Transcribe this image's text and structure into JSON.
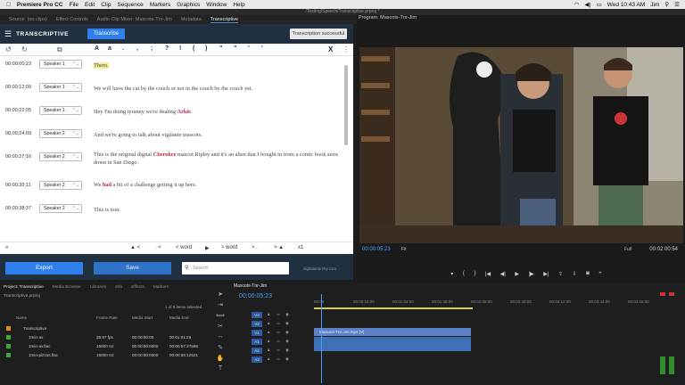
{
  "menubar": {
    "app": "Premiere Pro CC",
    "items": [
      "File",
      "Edit",
      "Clip",
      "Sequence",
      "Markers",
      "Graphics",
      "Window",
      "Help"
    ],
    "clock": "Wed 10:43 AM",
    "user": "Jim"
  },
  "titlebar": "/Testing/Speech/Transcriptive.prproj *",
  "tabs": [
    "Source: (no clips)",
    "Effect Controls",
    "Audio Clip Mixer: Mascots-Tnr-Jim",
    "Metadata",
    "Transcriptive"
  ],
  "transcriptive": {
    "title": "TRANSCRIPTIVE",
    "transcribe_button": "Transcribe",
    "status_button": "Transcription successful",
    "punct": [
      "A",
      "a",
      ".",
      ",",
      ";",
      "?",
      "!",
      "(",
      ")",
      "\"",
      "\"",
      "'",
      "'"
    ],
    "rows": [
      {
        "time": "00;00;00;23",
        "speaker": "Speaker 1",
        "segments": [
          {
            "t": "Thern.",
            "style": "hl"
          }
        ]
      },
      {
        "time": "00;00;12;09",
        "speaker": "Speaker 1",
        "segments": [
          {
            "t": "We will have the cat by the couch or not in the couch by the couch yet.",
            "style": ""
          }
        ]
      },
      {
        "time": "00;00;22;05",
        "speaker": "Speaker 1",
        "segments": [
          {
            "t": "Hey I'm doing tyranny we're dealing ",
            "style": ""
          },
          {
            "t": "Arkie",
            "style": "kw"
          },
          {
            "t": ".",
            "style": ""
          }
        ]
      },
      {
        "time": "00;00;24;09",
        "speaker": "Speaker 2",
        "segments": [
          {
            "t": "And we're going to talk about vigilante mascots.",
            "style": ""
          }
        ]
      },
      {
        "time": "00;00;27;16",
        "speaker": "Speaker 2",
        "segments": [
          {
            "t": "This is the original digital ",
            "style": ""
          },
          {
            "t": "Cherokee",
            "style": "kw"
          },
          {
            "t": " mascot Ripley and it's an alien that I bought in from a comic book store down in San Diego.",
            "style": ""
          }
        ]
      },
      {
        "time": "00;00;35;11",
        "speaker": "Speaker 2",
        "segments": [
          {
            "t": "We ",
            "style": ""
          },
          {
            "t": "had",
            "style": "kw"
          },
          {
            "t": " a bit of a challenge getting it up here.",
            "style": ""
          }
        ]
      },
      {
        "time": "00;00;38;37",
        "speaker": "Speaker 2",
        "segments": [
          {
            "t": "This is tour.",
            "style": ""
          }
        ]
      }
    ],
    "nav": {
      "prev": "«",
      "speaker_prev": "▲ <",
      "word_prev": "< word",
      "play": "▶",
      "word_next": "> word",
      "speaker_next": "> ▲",
      "speed": "x1"
    },
    "export_button": "Export",
    "save_button": "Save",
    "search_placeholder": "Search",
    "brand": "digitalanarchy.com"
  },
  "program": {
    "title": "Program: Mascots-Tnr-Jim",
    "timecode": "00:00:05:23",
    "fit": "Fit",
    "full": "Full",
    "duration": "00:02:00:54"
  },
  "project": {
    "tabs": [
      "Project: Transcriptive",
      "Media Browser",
      "Libraries",
      "Info",
      "Effects",
      "Markers"
    ],
    "path": "Transcriptive.prproj",
    "count": "1 of 8 items selected",
    "columns": [
      "Name",
      "Frame Rate",
      "Media Start",
      "Media End"
    ],
    "items": [
      {
        "name": "Transcriptive",
        "rate": "",
        "start": "",
        "end": "",
        "color": "#e08a1e"
      },
      {
        "name": "1min-av",
        "rate": "29.97 fps",
        "start": "00:00:00:00",
        "end": "00:01:01:25",
        "color": "#3aaa3a"
      },
      {
        "name": "1min-av.flac",
        "rate": "16000 Hz",
        "start": "00:00:00:0000",
        "end": "00:00:57:27569",
        "color": "#3aaa3a"
      },
      {
        "name": "1min-pizzas.flac",
        "rate": "16000 Hz",
        "start": "00:00:00:0000",
        "end": "00:00:58:12521",
        "color": "#3aaa3a"
      }
    ]
  },
  "timeline": {
    "sequence": "Mascots-Tnr-Jim",
    "timecode": "00:00:05:23",
    "ruler": [
      "00:00",
      "00:00:16:00",
      "00:01:04:00",
      "00:01:36:00",
      "00:02:08:00",
      "00:02:40:02",
      "00:03:12:00",
      "00:03:44:00",
      "00:04:16:00"
    ],
    "tracks": [
      "V3",
      "V2",
      "V1",
      "A1",
      "A2",
      "A3"
    ],
    "clip_label": "Mascots-Tnr-Jim.mp4 [V]"
  }
}
